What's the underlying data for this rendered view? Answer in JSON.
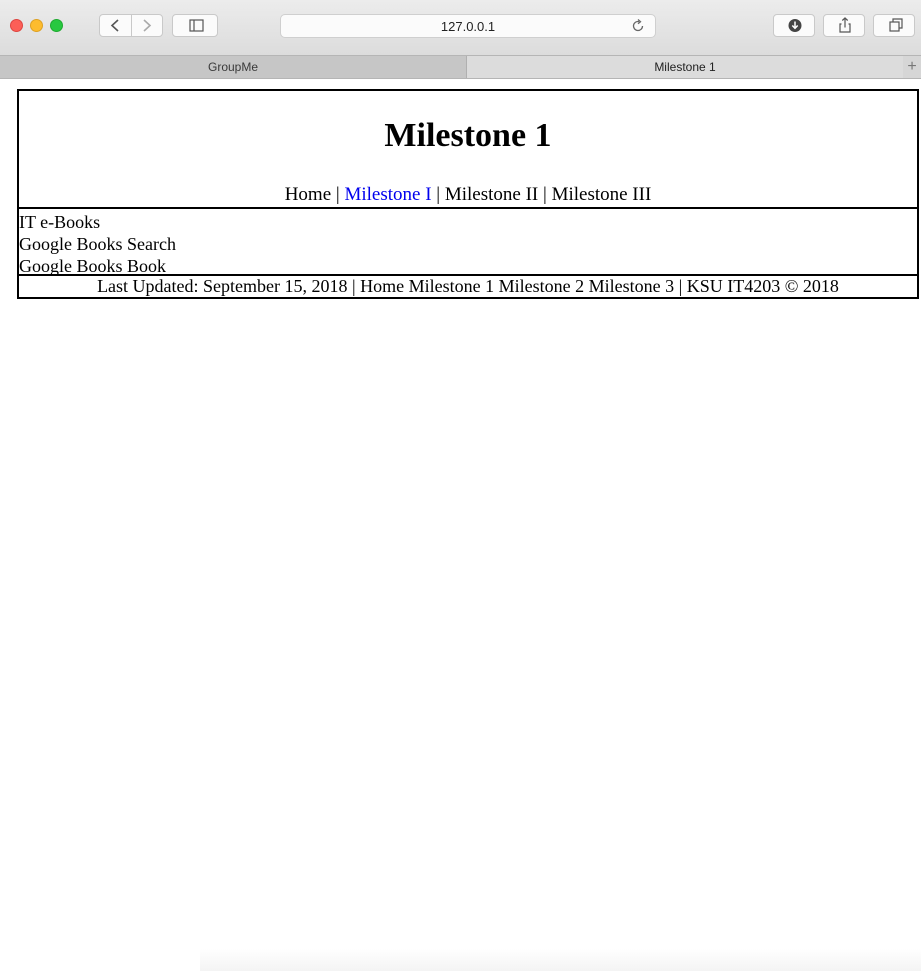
{
  "browser": {
    "url": "127.0.0.1",
    "tabs": [
      {
        "label": "GroupMe"
      },
      {
        "label": "Milestone 1"
      }
    ],
    "new_tab": "+"
  },
  "page": {
    "title": "Milestone 1",
    "nav": {
      "home": "Home",
      "sep": "|",
      "m1": "Milestone I",
      "m2": "Milestone II",
      "m3": "Milestone III",
      "active": "Milestone I",
      "active_color": "#0000ee"
    },
    "sidebar": [
      {
        "label": "IT e-Books"
      },
      {
        "label": "Google Books Search"
      },
      {
        "label": "Google Books Book"
      }
    ],
    "footer": {
      "updated": "Last Updated: September 15, 2018",
      "sep": "|",
      "home": "Home",
      "m1": "Milestone 1",
      "m2": "Milestone 2",
      "m3": "Milestone 3",
      "copyright": "KSU IT4203 © 2018"
    }
  },
  "icons": [
    "close-icon",
    "minimize-icon",
    "zoom-icon",
    "back-icon",
    "forward-icon",
    "sidebar-icon",
    "reload-icon",
    "download-icon",
    "share-icon",
    "tabs-overview-icon"
  ]
}
